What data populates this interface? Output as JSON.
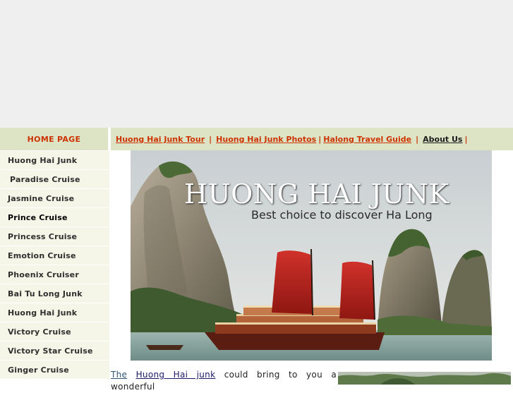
{
  "home": {
    "label": "HOME PAGE"
  },
  "nav": {
    "items": [
      {
        "label": "Huong Hai Junk Tour"
      },
      {
        "label": "Huong Hai Junk  Photos"
      },
      {
        "label": "Halong Travel Guide"
      },
      {
        "label": "About Us"
      }
    ],
    "separator": "|"
  },
  "sidebar": {
    "items": [
      {
        "label": "Huong Hai Junk"
      },
      {
        "label": "Paradise Cruise"
      },
      {
        "label": "Jasmine Cruise"
      },
      {
        "label": "Prince Cruise"
      },
      {
        "label": "Princess Cruise"
      },
      {
        "label": "Emotion Cruise"
      },
      {
        "label": "Phoenix Cruiser"
      },
      {
        "label": "Bai Tu Long Junk"
      },
      {
        "label": "Huong Hai Junk"
      },
      {
        "label": "Victory Cruise"
      },
      {
        "label": "Victory Star Cruise"
      },
      {
        "label": "Ginger Cruise"
      }
    ]
  },
  "banner": {
    "title": "HUONG HAI JUNK",
    "subtitle": "Best choice to discover Ha Long"
  },
  "intro": {
    "the": "The",
    "link": "Huong  Hai  junk",
    "text": " could bring to you  a wonderful"
  }
}
